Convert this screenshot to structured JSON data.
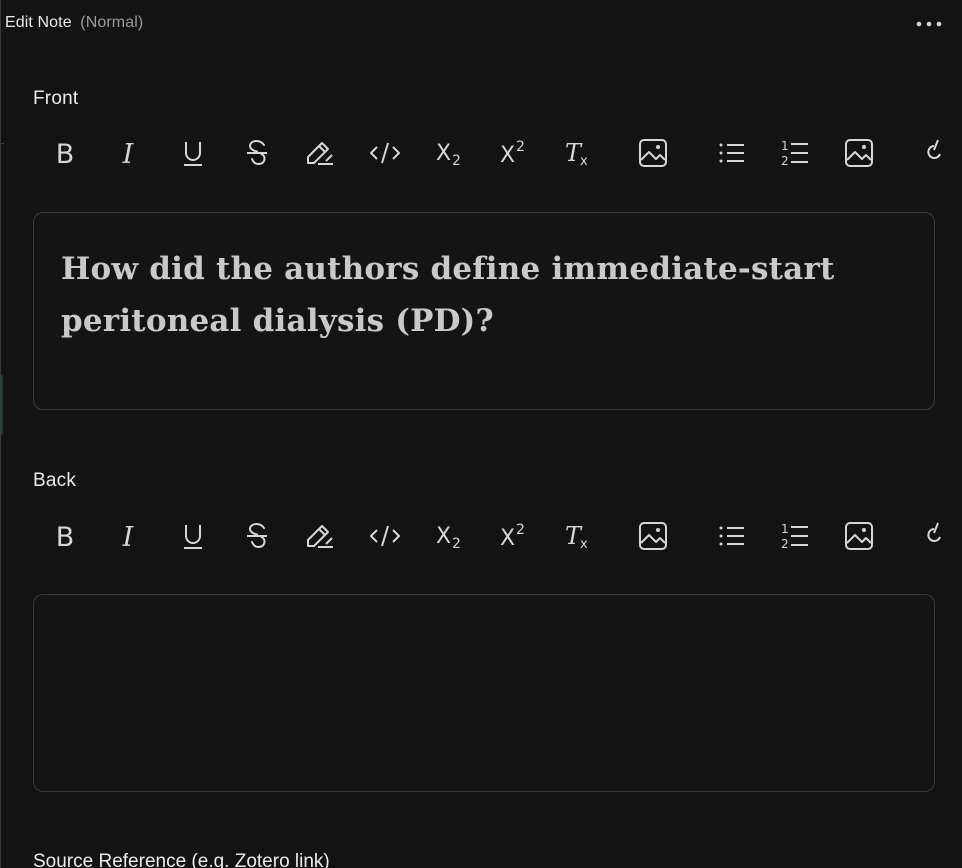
{
  "header": {
    "title": "Edit Note",
    "mode": "(Normal)"
  },
  "front": {
    "label": "Front",
    "content": "How did the authors define immediate-start peritoneal dialysis (PD)?"
  },
  "back": {
    "label": "Back",
    "content": ""
  },
  "toolbar": {
    "bold": "B",
    "italic": "I",
    "underline": "U",
    "strike": "S",
    "subscript_base": "X",
    "subscript_mark": "2",
    "superscript_base": "X",
    "superscript_mark": "2",
    "clear_base": "T",
    "clear_mark": "x",
    "ordered_list_marks": [
      "1",
      "2"
    ]
  },
  "source_reference": {
    "label": "Source Reference (e.g. Zotero link)"
  },
  "colors": {
    "background": "#131314",
    "border": "#3b3b3e",
    "text": "#e6e6e6",
    "muted": "#9a9a9c",
    "icon": "#d6d6d8"
  }
}
